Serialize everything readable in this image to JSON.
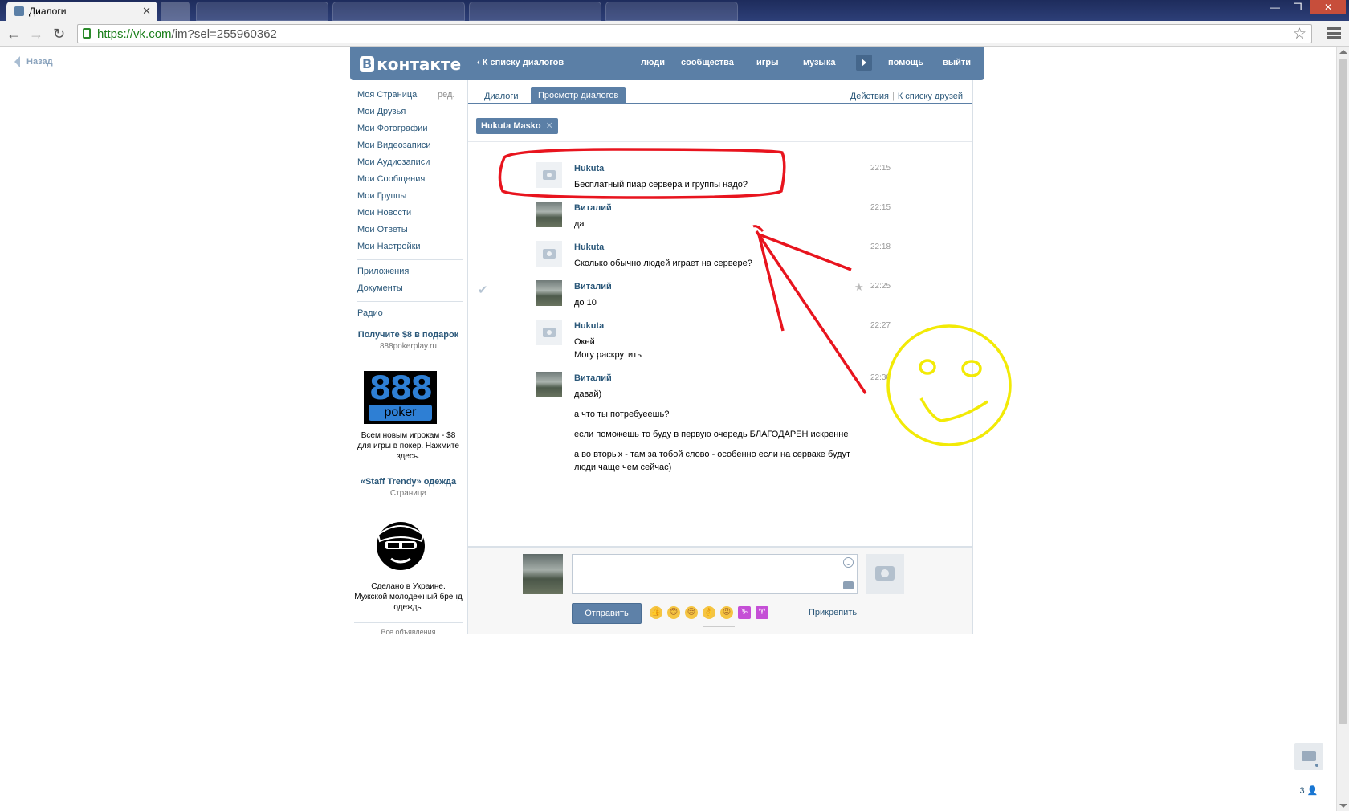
{
  "browser": {
    "active_tab_title": "Диалоги",
    "url_host": "https://vk.com",
    "url_path": "/im?sel=255960362",
    "window_controls": [
      "—",
      "❐",
      "✕"
    ]
  },
  "page": {
    "back_label": "Назад"
  },
  "header": {
    "logo": "контакте",
    "logo_badge": "В",
    "to_dialogs": "К списку диалогов",
    "nav": [
      "люди",
      "сообщества",
      "игры",
      "музыка",
      "помощь",
      "выйти"
    ]
  },
  "left_menu": {
    "edit": "ред.",
    "items": [
      "Моя Страница",
      "Мои Друзья",
      "Мои Фотографии",
      "Мои Видеозаписи",
      "Мои Аудиозаписи",
      "Мои Сообщения",
      "Мои Группы",
      "Мои Новости",
      "Мои Ответы",
      "Мои Настройки"
    ],
    "items2": [
      "Приложения",
      "Документы"
    ],
    "items3": [
      "Радио"
    ]
  },
  "ads": {
    "poker": {
      "title": "Получите $8 в подарок",
      "domain": "888pokerplay.ru",
      "image_digits": "888",
      "image_word": "poker",
      "description": "Всем новым игрокам - $8 для игры в покер. Нажмите здесь."
    },
    "staff": {
      "title": "«Staff Trendy» одежда",
      "subtitle": "Страница",
      "description": "Сделано в Украине. Мужской молодежный бренд одежды"
    },
    "all": "Все объявления"
  },
  "dialog": {
    "tab_dialogs": "Диалоги",
    "tab_view": "Просмотр диалогов",
    "actions": "Действия",
    "to_friends": "К списку друзей",
    "chip_name": "Hukuta Masko",
    "messages": [
      {
        "author": "Hukuta",
        "time": "22:15",
        "lines": [
          "Бесплатный пиар сервера и группы надо?"
        ]
      },
      {
        "author": "Виталий",
        "time": "22:15",
        "lines": [
          "да"
        ]
      },
      {
        "author": "Hukuta",
        "time": "22:18",
        "lines": [
          "Сколько обычно людей играет на сервере?"
        ]
      },
      {
        "author": "Виталий",
        "time": "22:25",
        "lines": [
          "до 10"
        ]
      },
      {
        "author": "Hukuta",
        "time": "22:27",
        "lines": [
          "Окей",
          "Могу раскрутить"
        ]
      },
      {
        "author": "Виталий",
        "time": "22:30",
        "lines": [
          "давай)",
          "а что ты потребуеешь?",
          "если поможешь то буду в первую очередь БЛАГОДАРЕН искренне",
          "а во вторых - там за тобой слово - особенно если на серваке будут люди чаще чем сейчас)"
        ]
      }
    ],
    "send_label": "Отправить",
    "attach_label": "Прикрепить",
    "emojis": [
      "👍",
      "😊",
      "😒",
      "👌",
      "😜",
      "♑",
      "♈"
    ]
  },
  "sidebar_right": {
    "online_count": "3"
  },
  "colors": {
    "brand": "#5b7fa6",
    "link": "#2b587a",
    "annotation_red": "#e8141e",
    "annotation_yellow": "#f2ea06"
  }
}
